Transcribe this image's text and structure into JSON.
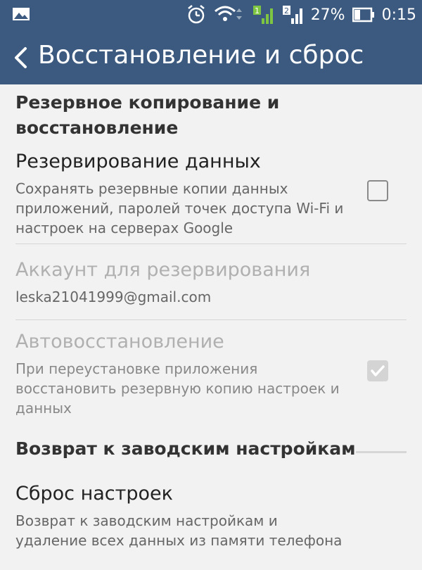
{
  "status": {
    "battery": "27%",
    "time": "0:15"
  },
  "appbar": {
    "title": "Восстановление и сброс"
  },
  "backup_section": {
    "header": "Резервное копирование и восстановление",
    "backup_data": {
      "title": "Резервирование данных",
      "summary": "Сохранять резервные копии данных приложений, паролей точек доступа Wi-Fi и настроек на серверах Google"
    },
    "backup_account": {
      "title": "Аккаунт для резервирования",
      "summary": "leska21041999@gmail.com"
    },
    "auto_restore": {
      "title": "Автовосстановление",
      "summary": "При переустановке приложения восстановить резервную копию настроек и данных"
    }
  },
  "factory_section": {
    "header": "Возврат к заводским настройкам",
    "reset": {
      "title": "Сброс настроек",
      "summary": "Возврат к заводским настройкам и удаление всех данных из памяти телефона"
    }
  }
}
